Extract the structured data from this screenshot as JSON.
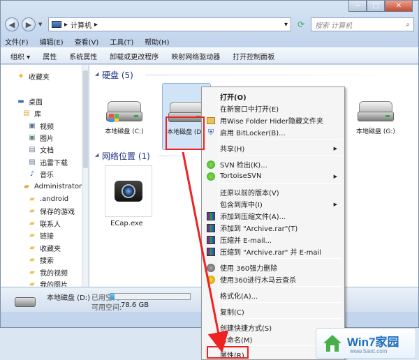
{
  "window": {
    "breadcrumb": "计算机",
    "controls": {
      "minimize": "─",
      "maximize": "□",
      "close": "✕"
    }
  },
  "search": {
    "placeholder": "搜索 计算机"
  },
  "menubar": [
    "文件(F)",
    "编辑(E)",
    "查看(V)",
    "工具(T)",
    "帮助(H)"
  ],
  "toolbar": [
    "组织 ▾",
    "属性",
    "系统属性",
    "卸载或更改程序",
    "映射网络驱动器",
    "打开控制面板"
  ],
  "sidebar": {
    "items": [
      {
        "label": "收藏夹",
        "icon": "star-icon",
        "glyph": "★",
        "color": "#e8b81e"
      },
      {
        "label": "桌面",
        "icon": "desktop-icon",
        "glyph": "▬",
        "color": "#3a6fb5"
      },
      {
        "label": "库",
        "icon": "library-icon",
        "glyph": "▤",
        "color": "#d8a93a"
      },
      {
        "label": "视频",
        "icon": "video-icon",
        "glyph": "▣",
        "color": "#5a6f8a"
      },
      {
        "label": "图片",
        "icon": "pictures-icon",
        "glyph": "▣",
        "color": "#5a8a6f"
      },
      {
        "label": "文档",
        "icon": "documents-icon",
        "glyph": "▤",
        "color": "#6a7a9a"
      },
      {
        "label": "迅雷下载",
        "icon": "thunder-download-icon",
        "glyph": "▤",
        "color": "#6a7a9a"
      },
      {
        "label": "音乐",
        "icon": "music-icon",
        "glyph": "♪",
        "color": "#3a6fb5"
      },
      {
        "label": "Administrator",
        "icon": "user-folder-icon",
        "glyph": "▰",
        "color": "#d8a93a"
      },
      {
        "label": ".android",
        "icon": "folder-icon",
        "glyph": "▰",
        "color": "#e8c35a"
      },
      {
        "label": "保存的游戏",
        "icon": "saved-games-icon",
        "glyph": "▰",
        "color": "#e8c35a"
      },
      {
        "label": "联系人",
        "icon": "contacts-icon",
        "glyph": "▰",
        "color": "#e8c35a"
      },
      {
        "label": "链接",
        "icon": "links-icon",
        "glyph": "▰",
        "color": "#e8c35a"
      },
      {
        "label": "收藏夹",
        "icon": "favorites-folder-icon",
        "glyph": "▰",
        "color": "#e8c35a"
      },
      {
        "label": "搜索",
        "icon": "searches-icon",
        "glyph": "▰",
        "color": "#e8c35a"
      },
      {
        "label": "我的视频",
        "icon": "my-videos-icon",
        "glyph": "▰",
        "color": "#e8c35a"
      },
      {
        "label": "我的图片",
        "icon": "my-pictures-icon",
        "glyph": "▰",
        "color": "#e8c35a"
      }
    ]
  },
  "content": {
    "hdd_group": "硬盘 (5)",
    "network_group": "网络位置 (1)",
    "drives": [
      {
        "label": "本地磁盘 (C:)"
      },
      {
        "label": "本地磁盘 (D:)"
      },
      {
        "label": "本地磁盘 (G:)"
      }
    ],
    "network_item": "ECap.exe"
  },
  "status": {
    "drive_name": "本地磁盘 (D:)",
    "used_label": "已用空间:",
    "free_label": "可用空间:",
    "free_value": "78.6 GB",
    "used_fraction": 0.05
  },
  "context_menu": {
    "items": [
      {
        "label": "打开(O)",
        "bold": true
      },
      {
        "label": "在新窗口中打开(E)"
      },
      {
        "label": "用Wise Folder Hider隐藏文件夹",
        "icon": "wise-folder-icon"
      },
      {
        "label": "启用 BitLocker(B)...",
        "icon": "bitlocker-shield-icon"
      },
      {
        "label": "共享(H)",
        "submenu": true
      },
      {
        "label": "SVN 检出(K)...",
        "icon": "svn-checkout-icon"
      },
      {
        "label": "TortoiseSVN",
        "icon": "tortoisesvn-icon",
        "submenu": true
      },
      {
        "label": "还原以前的版本(V)"
      },
      {
        "label": "包含到库中(I)",
        "submenu": true
      },
      {
        "label": "添加到压缩文件(A)...",
        "icon": "winrar-icon"
      },
      {
        "label": "添加到 \"Archive.rar\"(T)",
        "icon": "winrar-icon"
      },
      {
        "label": "压缩并 E-mail...",
        "icon": "winrar-icon"
      },
      {
        "label": "压缩到 \"Archive.rar\" 并 E-mail",
        "icon": "winrar-icon"
      },
      {
        "label": "使用 360强力删除",
        "icon": "360-delete-icon"
      },
      {
        "label": "使用360进行木马云查杀",
        "icon": "360-scan-icon"
      },
      {
        "label": "格式化(A)..."
      },
      {
        "label": "复制(C)"
      },
      {
        "label": "创建快捷方式(S)"
      },
      {
        "label": "重命名(M)"
      },
      {
        "label": "属性(R)"
      }
    ]
  },
  "watermark": {
    "title": "Win7家园",
    "url": "www.5aixt.com"
  },
  "colors": {
    "accent": "#1e3287",
    "highlight": "#e22222"
  }
}
